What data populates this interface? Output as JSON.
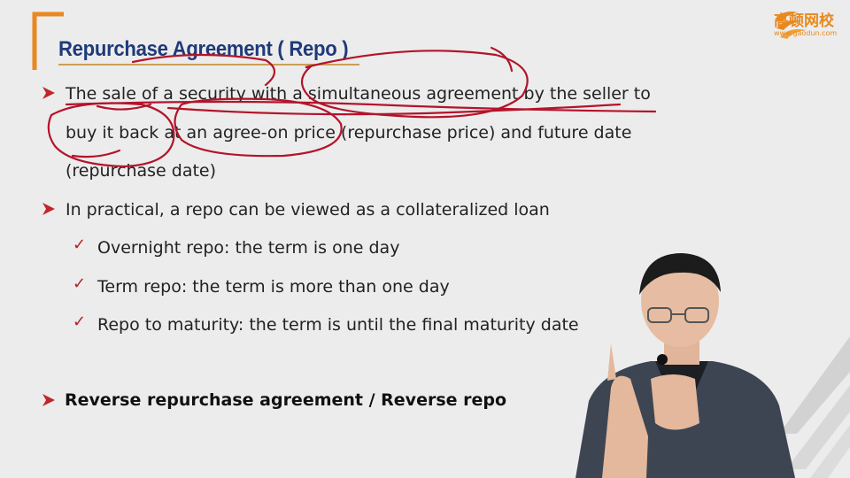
{
  "header": {
    "title": "Repurchase Agreement ( Repo )"
  },
  "logo": {
    "name": "高顿网校",
    "url": "www.gaodun.com"
  },
  "bullets": {
    "b1_line1": "The sale of a security with a simultaneous agreement by the seller to",
    "b1_line2": "buy it back at an agree-on price (repurchase price) and future date",
    "b1_line3": "(repurchase date)",
    "b2": "In practical, a repo can be viewed as a collateralized loan",
    "sub1": "Overnight repo: the term is one day",
    "sub2": "Term repo: the term is more than one day",
    "sub3": "Repo to maturity: the term is until the final maturity date",
    "b3": "Reverse repurchase agreement / Reverse repo"
  },
  "colors": {
    "title": "#1f3a7a",
    "accent_orange": "#e8891f",
    "bullet_red": "#c0262a",
    "annotation_red": "#b3142b"
  },
  "icons": {
    "bullet": "arrowhead-bullet-icon",
    "sub_bullet": "checkmark-icon",
    "brand": "gaodun-logo-icon"
  }
}
